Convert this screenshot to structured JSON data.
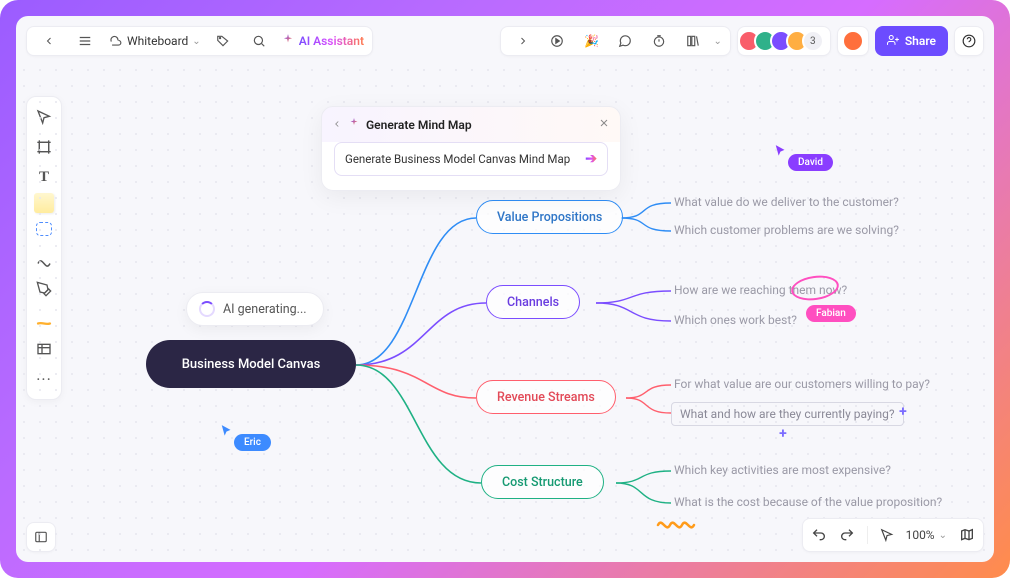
{
  "header": {
    "board_type": "Whiteboard",
    "ai_assistant": "AI Assistant",
    "share_label": "Share",
    "avatar_overflow_count": "3"
  },
  "ai_panel": {
    "title": "Generate Mind Map",
    "prompt": "Generate Business Model Canvas Mind Map"
  },
  "status": {
    "generating": "AI generating..."
  },
  "mindmap": {
    "root": "Business Model Canvas",
    "branches": [
      {
        "label": "Value Propositions",
        "color": "#2f8df5",
        "leaves": [
          "What value do we deliver to the customer?",
          "Which customer problems are we solving?"
        ]
      },
      {
        "label": "Channels",
        "color": "#7b4dff",
        "leaves": [
          "How are we reaching them now?",
          "Which ones work best?"
        ]
      },
      {
        "label": "Revenue Streams",
        "color": "#ff5f6d",
        "leaves": [
          "For what value are our customers willing to pay?",
          "What and how are they currently paying?"
        ]
      },
      {
        "label": "Cost Structure",
        "color": "#1fb184",
        "leaves": [
          "Which key activities are most expensive?",
          "What is the cost because of the value proposition?"
        ]
      }
    ]
  },
  "cursors": {
    "eric": {
      "name": "Eric",
      "color": "#3d8bff"
    },
    "david": {
      "name": "David",
      "color": "#8a3dff"
    },
    "fabian": {
      "name": "Fabian",
      "color": "#ff4fc0"
    }
  },
  "zoom": {
    "level": "100%"
  }
}
